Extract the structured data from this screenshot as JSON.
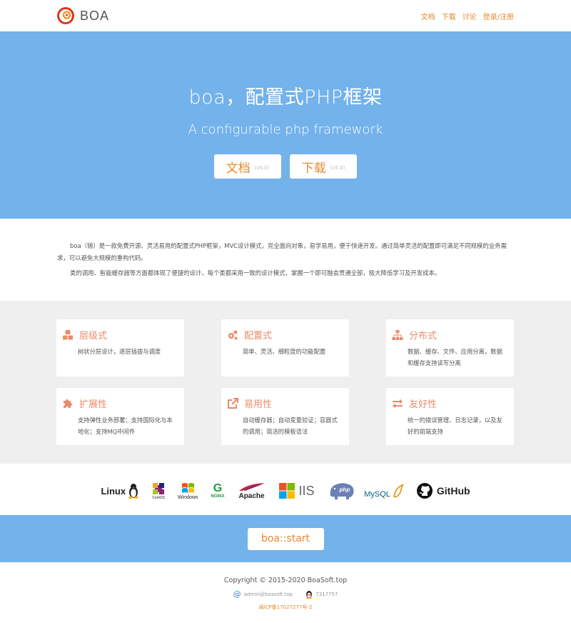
{
  "brand": {
    "name": "BOA"
  },
  "nav": [
    {
      "label": "文档"
    },
    {
      "label": "下载"
    },
    {
      "label": "讨论"
    },
    {
      "label": "登录/注册"
    }
  ],
  "hero": {
    "title": "boa，配置式PHP框架",
    "subtitle": "A configurable php framework",
    "buttons": [
      {
        "label": "文档",
        "version": "(v5.0)"
      },
      {
        "label": "下载",
        "version": "(v5.0)"
      }
    ]
  },
  "intro": {
    "paragraphs": [
      "boa（锦）是一款免费开源、灵活易用的配置式PHP框架，MVC设计模式，完全面向对象，易学易用，便于快速开发。通过简单灵活的配置即可满足不同规模的业务需求，可以避免大规模的重构代码。",
      "类的调用、智能缓存器等方面都体现了便捷的设计。每个类都采用一致的设计模式，掌握一个即可融会贯通全部，极大降低学习及开发成本。"
    ]
  },
  "features": [
    {
      "icon": "cubes-icon",
      "title": "层级式",
      "desc": "树状分层设计，逐层插拔与调度"
    },
    {
      "icon": "gears-icon",
      "title": "配置式",
      "desc": "简单、灵活、细粒度的功能配置"
    },
    {
      "icon": "sitemap-icon",
      "title": "分布式",
      "desc": "数据、缓存、文件、应用分离，数据和缓存支持读写分离"
    },
    {
      "icon": "puzzle-icon",
      "title": "扩展性",
      "desc": "支持弹性业务部署；支持国际化与本地化；支持MQ中间件"
    },
    {
      "icon": "external-link-icon",
      "title": "易用性",
      "desc": "自动缓存器；自动变量验证；容器式的调用；简洁的模板语法"
    },
    {
      "icon": "exchange-icon",
      "title": "友好性",
      "desc": "统一的错误管理、日志记录，以及友好的前端支持"
    }
  ],
  "logos": {
    "linux": "Linux",
    "centos": "CentOS",
    "windows": "Windows",
    "nginx": "NGINX",
    "apache": "Apache",
    "iis": "IIS",
    "php": "php",
    "mysql": "MySQL",
    "github": "GitHub"
  },
  "start": {
    "label": "boa::start"
  },
  "footer": {
    "copyright": "Copyright © 2015-2020 BoaSoft.top",
    "email": "admin@boasoft.top",
    "qq": "7317757",
    "icp": "闽ICP备17027277号-2"
  },
  "colors": {
    "accent": "#e58a2f",
    "hero_bg": "#73b2ea",
    "feature_title": "#ea8b6a"
  }
}
